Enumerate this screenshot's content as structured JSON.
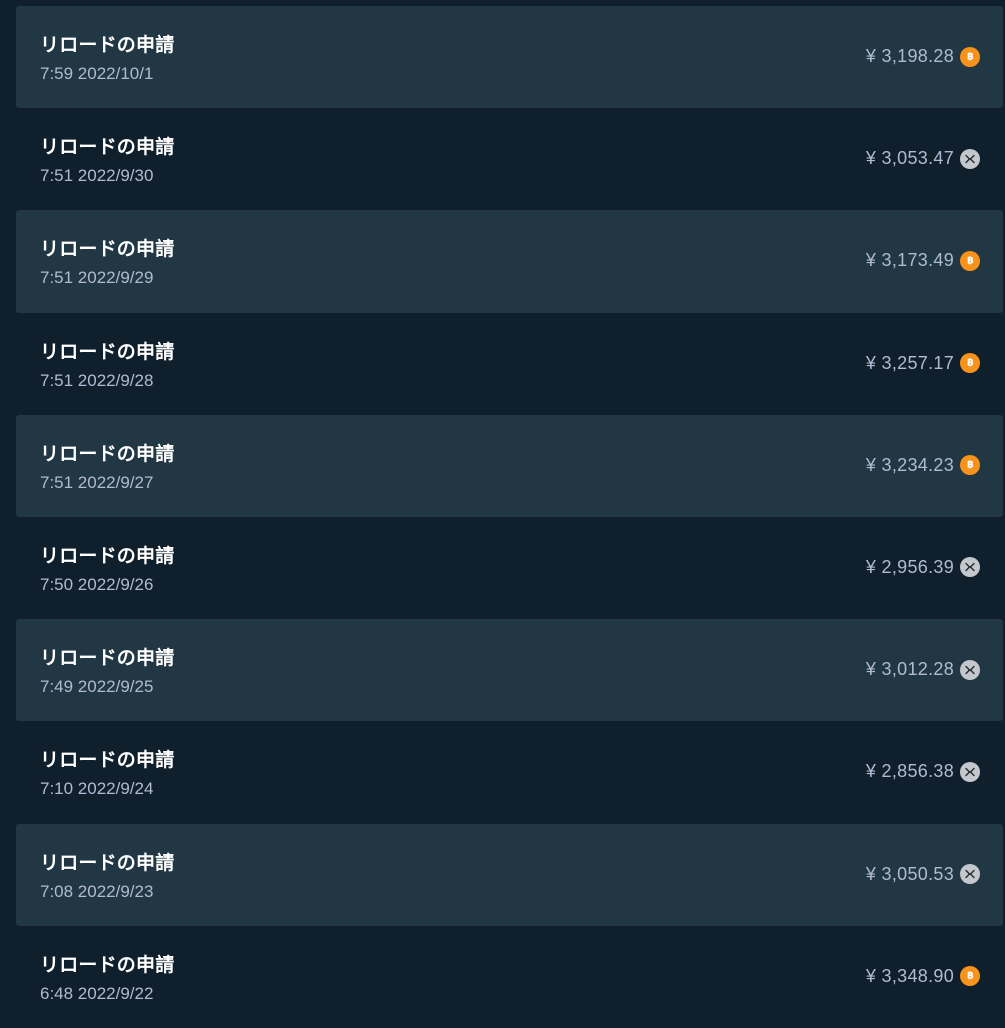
{
  "colors": {
    "background": "#0f1f2c",
    "row_shaded": "#213744",
    "title": "#ffffff",
    "muted": "#b1bad3",
    "btc": "#f7931a",
    "xrp": "#c4c7cc"
  },
  "rows": [
    {
      "title": "リロードの申請",
      "time": "7:59 2022/10/1",
      "amount": "¥ 3,198.28",
      "coin": "btc-icon",
      "shaded": true
    },
    {
      "title": "リロードの申請",
      "time": "7:51 2022/9/30",
      "amount": "¥ 3,053.47",
      "coin": "xrp-icon",
      "shaded": false
    },
    {
      "title": "リロードの申請",
      "time": "7:51 2022/9/29",
      "amount": "¥ 3,173.49",
      "coin": "btc-icon",
      "shaded": true
    },
    {
      "title": "リロードの申請",
      "time": "7:51 2022/9/28",
      "amount": "¥ 3,257.17",
      "coin": "btc-icon",
      "shaded": false
    },
    {
      "title": "リロードの申請",
      "time": "7:51 2022/9/27",
      "amount": "¥ 3,234.23",
      "coin": "btc-icon",
      "shaded": true
    },
    {
      "title": "リロードの申請",
      "time": "7:50 2022/9/26",
      "amount": "¥ 2,956.39",
      "coin": "xrp-icon",
      "shaded": false
    },
    {
      "title": "リロードの申請",
      "time": "7:49 2022/9/25",
      "amount": "¥ 3,012.28",
      "coin": "xrp-icon",
      "shaded": true
    },
    {
      "title": "リロードの申請",
      "time": "7:10 2022/9/24",
      "amount": "¥ 2,856.38",
      "coin": "xrp-icon",
      "shaded": false
    },
    {
      "title": "リロードの申請",
      "time": "7:08 2022/9/23",
      "amount": "¥ 3,050.53",
      "coin": "xrp-icon",
      "shaded": true
    },
    {
      "title": "リロードの申請",
      "time": "6:48 2022/9/22",
      "amount": "¥ 3,348.90",
      "coin": "btc-icon",
      "shaded": false
    }
  ]
}
